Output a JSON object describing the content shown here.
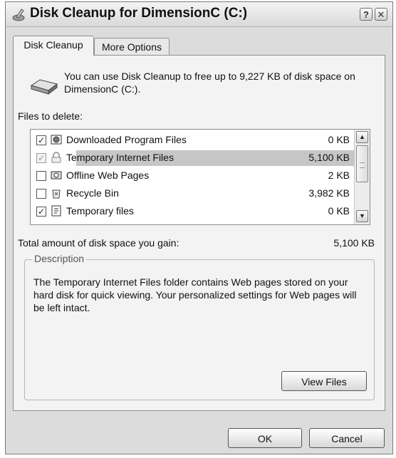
{
  "window": {
    "title": "Disk Cleanup for DimensionC (C:)",
    "help_button": "?",
    "close_button": "✕"
  },
  "tabs": [
    {
      "label": "Disk Cleanup",
      "active": true
    },
    {
      "label": "More Options",
      "active": false
    }
  ],
  "intro_text": "You can use Disk Cleanup to free up to 9,227 KB of disk space on DimensionC (C:).",
  "files_label": "Files to delete:",
  "files": [
    {
      "name": "Downloaded Program Files",
      "size": "0 KB",
      "checked": true,
      "dimmed": false,
      "icon": "program-files-icon"
    },
    {
      "name": "Temporary Internet Files",
      "size": "5,100 KB",
      "checked": true,
      "dimmed": true,
      "selected": true,
      "icon": "lock-icon"
    },
    {
      "name": "Offline Web Pages",
      "size": "2 KB",
      "checked": false,
      "dimmed": false,
      "icon": "offline-pages-icon"
    },
    {
      "name": "Recycle Bin",
      "size": "3,982 KB",
      "checked": false,
      "dimmed": false,
      "icon": "recycle-bin-icon"
    },
    {
      "name": "Temporary files",
      "size": "0 KB",
      "checked": true,
      "dimmed": false,
      "icon": "temp-files-icon"
    }
  ],
  "total": {
    "label": "Total amount of disk space you gain:",
    "value": "5,100 KB"
  },
  "description": {
    "legend": "Description",
    "text": "The Temporary Internet Files folder contains Web pages stored on your hard disk for quick viewing. Your personalized settings for Web pages will be left intact."
  },
  "buttons": {
    "view_files": "View Files",
    "ok": "OK",
    "cancel": "Cancel"
  },
  "colors": {
    "selection": "#c6c6c6",
    "panel": "#f3f3f3",
    "window": "#dcdcdc"
  }
}
